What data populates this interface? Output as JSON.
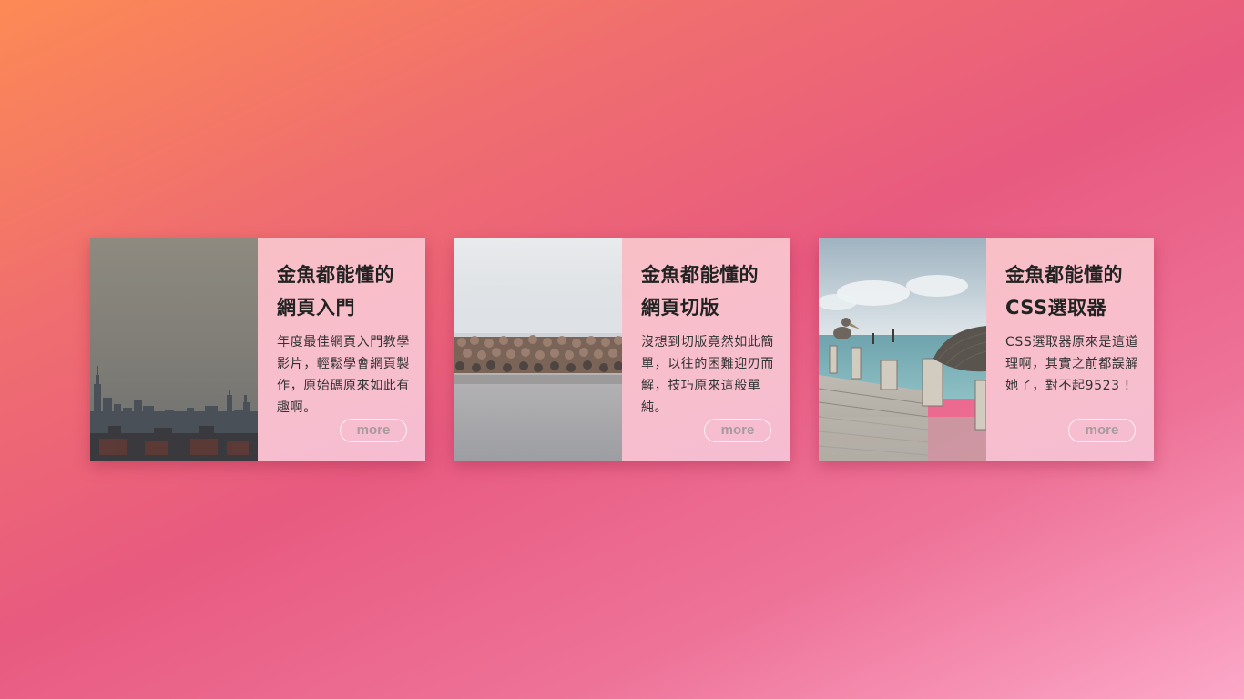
{
  "cards": [
    {
      "title_line1": "金魚都能懂的",
      "title_line2": "網頁入門",
      "description": "年度最佳網頁入門教學影片，輕鬆學會網頁製作，原始碼原來如此有趣啊。",
      "more_label": "more",
      "image": "city-skyline-image"
    },
    {
      "title_line1": "金魚都能懂的",
      "title_line2": "網頁切版",
      "description": "沒想到切版竟然如此簡單，以往的困難迎刃而解，技巧原來這般單純。",
      "more_label": "more",
      "image": "rock-breakwater-image"
    },
    {
      "title_line1": "金魚都能懂的",
      "title_line2": "CSS選取器",
      "description": "CSS選取器原來是這道理啊，其實之前都誤解她了，對不起9523 !",
      "more_label": "more",
      "image": "pier-pelicans-image"
    }
  ]
}
